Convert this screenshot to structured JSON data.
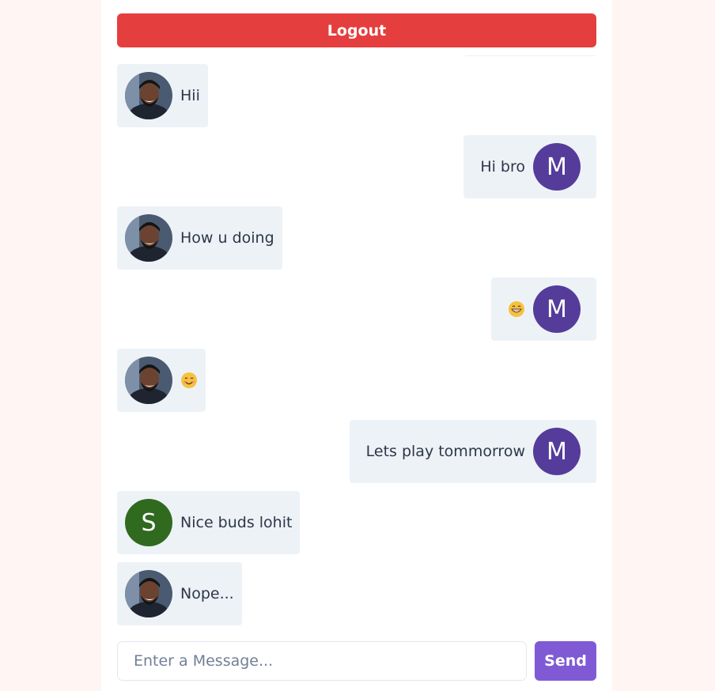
{
  "header": {
    "logout_label": "Logout"
  },
  "colors": {
    "logout": "#e53e3e",
    "bubble": "#edf2f7",
    "send": "#805ad5",
    "avatar_m": "#553c9a",
    "avatar_s": "#2f6a1f"
  },
  "messages": [
    {
      "side": "left",
      "avatar": "photo",
      "text": "Hii",
      "emoji": ""
    },
    {
      "side": "right",
      "avatar": "M",
      "avatar_color": "#553c9a",
      "text": "Hi bro",
      "emoji": ""
    },
    {
      "side": "left",
      "avatar": "photo",
      "text": "How u doing",
      "emoji": ""
    },
    {
      "side": "right",
      "avatar": "M",
      "avatar_color": "#553c9a",
      "text": "",
      "emoji": "grinning-face-icon"
    },
    {
      "side": "left",
      "avatar": "photo",
      "text": "",
      "emoji": "smiling-face-icon"
    },
    {
      "side": "right",
      "avatar": "M",
      "avatar_color": "#553c9a",
      "text": "Lets play tommorrow",
      "emoji": ""
    },
    {
      "side": "left",
      "avatar": "S",
      "avatar_color": "#2f6a1f",
      "text": "Nice buds lohit",
      "emoji": ""
    },
    {
      "side": "left",
      "avatar": "photo",
      "text": "Nope...",
      "emoji": ""
    }
  ],
  "composer": {
    "placeholder": "Enter a Message...",
    "value": "",
    "send_label": "Send"
  }
}
